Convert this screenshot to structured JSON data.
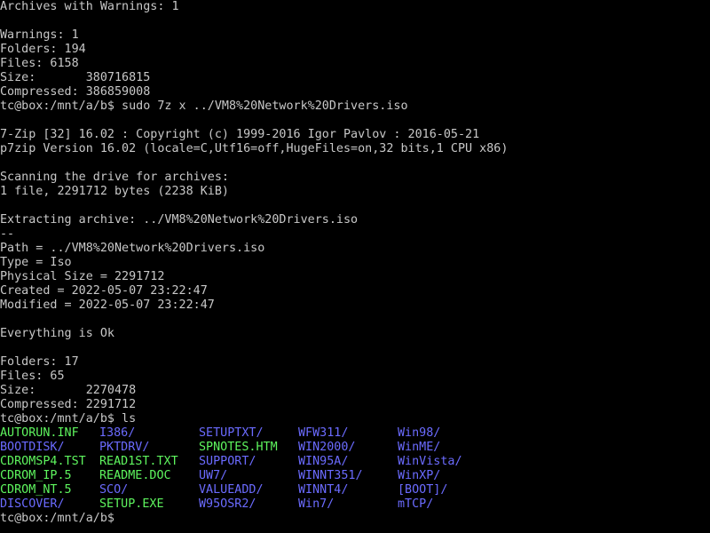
{
  "colors": {
    "background": "#000000",
    "text": "#c8c8c8",
    "directory": "#6b6bff",
    "executable_file": "#5ef55e"
  },
  "lines": [
    "Archives with Warnings: 1",
    "",
    "Warnings: 1",
    "Folders: 194",
    "Files: 6158",
    "Size:       380716815",
    "Compressed: 386859008",
    "tc@box:/mnt/a/b$ sudo 7z x ../VM8%20Network%20Drivers.iso",
    "",
    "7-Zip [32] 16.02 : Copyright (c) 1999-2016 Igor Pavlov : 2016-05-21",
    "p7zip Version 16.02 (locale=C,Utf16=off,HugeFiles=on,32 bits,1 CPU x86)",
    "",
    "Scanning the drive for archives:",
    "1 file, 2291712 bytes (2238 KiB)",
    "",
    "Extracting archive: ../VM8%20Network%20Drivers.iso",
    "--",
    "Path = ../VM8%20Network%20Drivers.iso",
    "Type = Iso",
    "Physical Size = 2291712",
    "Created = 2022-05-07 23:22:47",
    "Modified = 2022-05-07 23:22:47",
    "",
    "Everything is Ok",
    "",
    "Folders: 17",
    "Files: 65",
    "Size:       2270478",
    "Compressed: 2291712",
    "tc@box:/mnt/a/b$ ls"
  ],
  "ls_listing": [
    [
      {
        "name": "AUTORUN.INF",
        "type": "file"
      },
      {
        "name": "I386/",
        "type": "dir"
      },
      {
        "name": "SETUPTXT/",
        "type": "dir"
      },
      {
        "name": "WFW311/",
        "type": "dir"
      },
      {
        "name": "Win98/",
        "type": "dir"
      }
    ],
    [
      {
        "name": "BOOTDISK/",
        "type": "dir"
      },
      {
        "name": "PKTDRV/",
        "type": "dir"
      },
      {
        "name": "SPNOTES.HTM",
        "type": "file"
      },
      {
        "name": "WIN2000/",
        "type": "dir"
      },
      {
        "name": "WinME/",
        "type": "dir"
      }
    ],
    [
      {
        "name": "CDROMSP4.TST",
        "type": "file"
      },
      {
        "name": "READ1ST.TXT",
        "type": "file"
      },
      {
        "name": "SUPPORT/",
        "type": "dir"
      },
      {
        "name": "WIN95A/",
        "type": "dir"
      },
      {
        "name": "WinVista/",
        "type": "dir"
      }
    ],
    [
      {
        "name": "CDROM_IP.5",
        "type": "file"
      },
      {
        "name": "README.DOC",
        "type": "file"
      },
      {
        "name": "UW7/",
        "type": "dir"
      },
      {
        "name": "WINNT351/",
        "type": "dir"
      },
      {
        "name": "WinXP/",
        "type": "dir"
      }
    ],
    [
      {
        "name": "CDROM_NT.5",
        "type": "file"
      },
      {
        "name": "SCO/",
        "type": "dir"
      },
      {
        "name": "VALUEADD/",
        "type": "dir"
      },
      {
        "name": "WINNT4/",
        "type": "dir"
      },
      {
        "name": "[BOOT]/",
        "type": "dir"
      }
    ],
    [
      {
        "name": "DISCOVER/",
        "type": "dir"
      },
      {
        "name": "SETUP.EXE",
        "type": "file"
      },
      {
        "name": "W95OSR2/",
        "type": "dir"
      },
      {
        "name": "Win7/",
        "type": "dir"
      },
      {
        "name": "mTCP/",
        "type": "dir"
      }
    ]
  ],
  "prompt": "tc@box:/mnt/a/b$"
}
